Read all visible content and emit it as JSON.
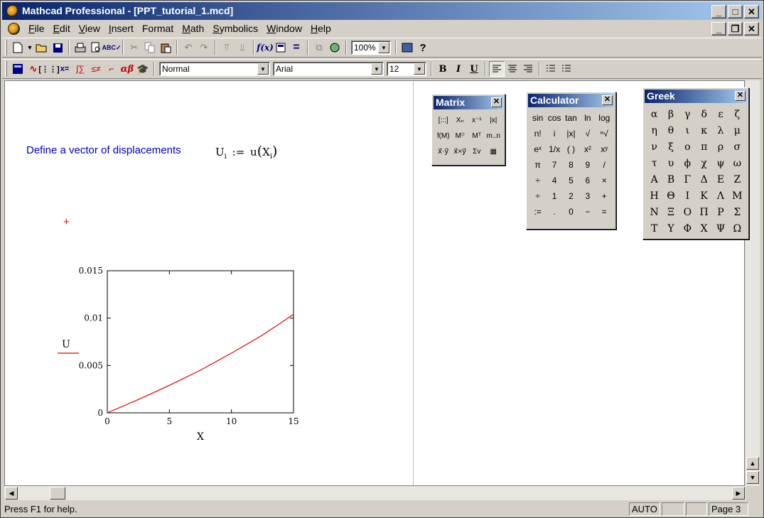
{
  "window": {
    "title": "Mathcad Professional - [PPT_tutorial_1.mcd]",
    "controls": [
      "_",
      "□",
      "✕"
    ]
  },
  "menu": {
    "items": [
      {
        "u": "F",
        "rest": "ile"
      },
      {
        "u": "E",
        "rest": "dit"
      },
      {
        "u": "V",
        "rest": "iew"
      },
      {
        "u": "I",
        "rest": "nsert"
      },
      {
        "u": "F",
        "rest": "ormat"
      },
      {
        "u": "M",
        "rest": "ath"
      },
      {
        "u": "S",
        "rest": "ymbolics"
      },
      {
        "u": "W",
        "rest": "indow"
      },
      {
        "u": "H",
        "rest": "elp"
      }
    ],
    "mdi_controls": [
      "_",
      "❐",
      "✕"
    ]
  },
  "toolbar1": {
    "zoom": "100%"
  },
  "toolbar2": {
    "style": "Normal",
    "font": "Arial",
    "size": "12",
    "bold": "B",
    "italic": "I",
    "underline": "U"
  },
  "document": {
    "text": "Define a vector of displacements",
    "equation": {
      "lhs": "U",
      "lhs_sub": "i",
      "assign": ":=",
      "func": "u",
      "arg": "X",
      "arg_sub": "i"
    },
    "crosshair": "+"
  },
  "chart_data": {
    "type": "line",
    "xlabel": "X",
    "ylabel": "U",
    "xlim": [
      0,
      15
    ],
    "ylim": [
      0,
      0.015
    ],
    "xticks": [
      "0",
      "5",
      "10",
      "15"
    ],
    "yticks": [
      "0",
      "0.005",
      "0.01",
      "0.015"
    ],
    "series": [
      {
        "color": "#e00000",
        "x": [
          0,
          2.5,
          5,
          7.5,
          10,
          12.5,
          15
        ],
        "y": [
          0,
          0.0014,
          0.0029,
          0.0045,
          0.0063,
          0.0082,
          0.0104
        ]
      }
    ]
  },
  "palettes": {
    "matrix": {
      "title": "Matrix",
      "cells": [
        "[:::]",
        "Xₙ",
        "x⁻¹",
        "|x|",
        "f(M)",
        "M⁽⁾",
        "Mᵀ",
        "m..n",
        "x⃗·y⃗",
        "x⃗×y⃗",
        "Σv",
        "▦"
      ]
    },
    "calculator": {
      "title": "Calculator",
      "cells": [
        "sin",
        "cos",
        "tan",
        "ln",
        "log",
        "n!",
        "i",
        "|x|",
        "√",
        "ⁿ√",
        "eˣ",
        "1/x",
        "( )",
        "x²",
        "xʸ",
        "π",
        "7",
        "8",
        "9",
        "/",
        "÷",
        "4",
        "5",
        "6",
        "×",
        "÷",
        "1",
        "2",
        "3",
        "+",
        ":=",
        ".",
        "0",
        "−",
        "="
      ]
    },
    "greek": {
      "title": "Greek",
      "cells": [
        "α",
        "β",
        "γ",
        "δ",
        "ε",
        "ζ",
        "η",
        "θ",
        "ι",
        "κ",
        "λ",
        "μ",
        "ν",
        "ξ",
        "ο",
        "π",
        "ρ",
        "σ",
        "τ",
        "υ",
        "ϕ",
        "χ",
        "ψ",
        "ω",
        "Α",
        "Β",
        "Γ",
        "Δ",
        "Ε",
        "Ζ",
        "Η",
        "Θ",
        "Ι",
        "Κ",
        "Λ",
        "Μ",
        "Ν",
        "Ξ",
        "Ο",
        "Π",
        "Ρ",
        "Σ",
        "Τ",
        "Υ",
        "Φ",
        "Χ",
        "Ψ",
        "Ω"
      ]
    }
  },
  "status": {
    "help": "Press F1 for help.",
    "mode": "AUTO",
    "page": "Page 3"
  }
}
